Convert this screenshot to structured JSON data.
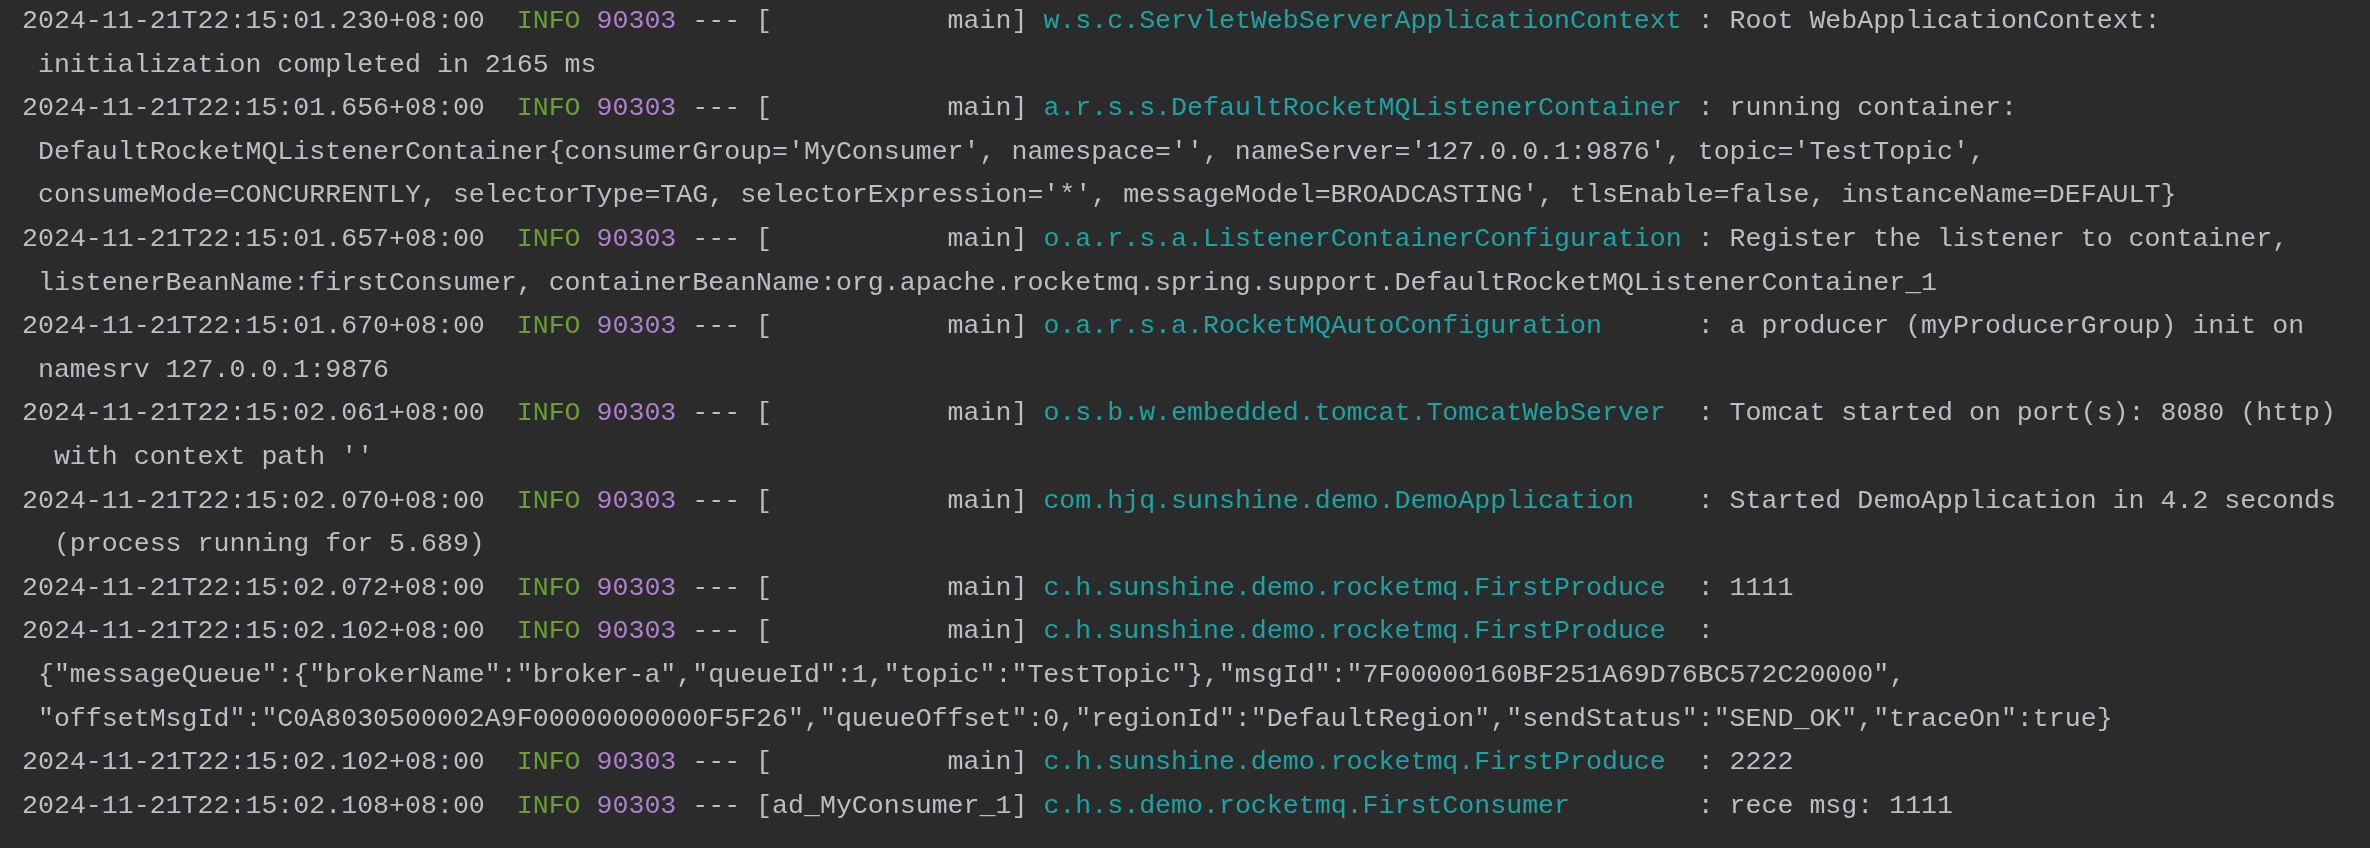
{
  "log_entries": [
    {
      "timestamp": "2024-11-21T22:15:01.230+08:00",
      "level": "INFO",
      "pid": "90303",
      "separator": "---",
      "thread": "[           main]",
      "logger": "w.s.c.ServletWebServerApplicationContext",
      "message": [
        ": Root WebApplicationContext:",
        "initialization completed in 2165 ms"
      ]
    },
    {
      "timestamp": "2024-11-21T22:15:01.656+08:00",
      "level": "INFO",
      "pid": "90303",
      "separator": "---",
      "thread": "[           main]",
      "logger": "a.r.s.s.DefaultRocketMQListenerContainer",
      "message": [
        ": running container:",
        "DefaultRocketMQListenerContainer{consumerGroup='MyConsumer', namespace='', nameServer='127.0.0.1:9876', topic='TestTopic',",
        "consumeMode=CONCURRENTLY, selectorType=TAG, selectorExpression='*', messageModel=BROADCASTING', tlsEnable=false, instanceName=DEFAULT}"
      ]
    },
    {
      "timestamp": "2024-11-21T22:15:01.657+08:00",
      "level": "INFO",
      "pid": "90303",
      "separator": "---",
      "thread": "[           main]",
      "logger": "o.a.r.s.a.ListenerContainerConfiguration",
      "message": [
        ": Register the listener to container,",
        "listenerBeanName:firstConsumer, containerBeanName:org.apache.rocketmq.spring.support.DefaultRocketMQListenerContainer_1"
      ]
    },
    {
      "timestamp": "2024-11-21T22:15:01.670+08:00",
      "level": "INFO",
      "pid": "90303",
      "separator": "---",
      "thread": "[           main]",
      "logger": "o.a.r.s.a.RocketMQAutoConfiguration",
      "message": [
        ": a producer (myProducerGroup) init on",
        "namesrv 127.0.0.1:9876"
      ]
    },
    {
      "timestamp": "2024-11-21T22:15:02.061+08:00",
      "level": "INFO",
      "pid": "90303",
      "separator": "---",
      "thread": "[           main]",
      "logger": "o.s.b.w.embedded.tomcat.TomcatWebServer",
      "message": [
        ": Tomcat started on port(s): 8080 (http)",
        " with context path ''"
      ]
    },
    {
      "timestamp": "2024-11-21T22:15:02.070+08:00",
      "level": "INFO",
      "pid": "90303",
      "separator": "---",
      "thread": "[           main]",
      "logger": "com.hjq.sunshine.demo.DemoApplication",
      "message": [
        ": Started DemoApplication in 4.2 seconds",
        " (process running for 5.689)"
      ]
    },
    {
      "timestamp": "2024-11-21T22:15:02.072+08:00",
      "level": "INFO",
      "pid": "90303",
      "separator": "---",
      "thread": "[           main]",
      "logger": "c.h.sunshine.demo.rocketmq.FirstProduce",
      "message": [
        ": 1111"
      ]
    },
    {
      "timestamp": "2024-11-21T22:15:02.102+08:00",
      "level": "INFO",
      "pid": "90303",
      "separator": "---",
      "thread": "[           main]",
      "logger": "c.h.sunshine.demo.rocketmq.FirstProduce",
      "message": [
        ":",
        "{\"messageQueue\":{\"brokerName\":\"broker-a\",\"queueId\":1,\"topic\":\"TestTopic\"},\"msgId\":\"7F00000160BF251A69D76BC572C20000\",",
        "\"offsetMsgId\":\"C0A8030500002A9F00000000000F5F26\",\"queueOffset\":0,\"regionId\":\"DefaultRegion\",\"sendStatus\":\"SEND_OK\",\"traceOn\":true}"
      ]
    },
    {
      "timestamp": "2024-11-21T22:15:02.102+08:00",
      "level": "INFO",
      "pid": "90303",
      "separator": "---",
      "thread": "[           main]",
      "logger": "c.h.sunshine.demo.rocketmq.FirstProduce",
      "message": [
        ": 2222"
      ]
    },
    {
      "timestamp": "2024-11-21T22:15:02.108+08:00",
      "level": "INFO",
      "pid": "90303",
      "separator": "---",
      "thread": "[ad_MyConsumer_1]",
      "logger": "c.h.s.demo.rocketmq.FirstConsumer",
      "message": [
        ": rece msg: 1111"
      ]
    }
  ]
}
